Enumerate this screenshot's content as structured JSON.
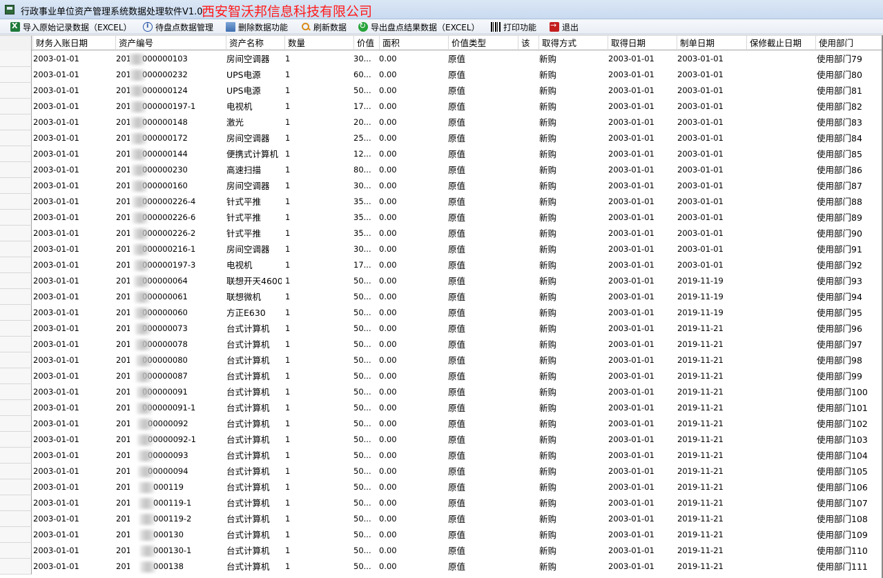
{
  "window": {
    "title": "行政事业单位资产管理系统数据处理软件V1.0",
    "brand_overlay": "西安智沃邦信息科技有限公司"
  },
  "toolbar": [
    {
      "label": "导入原始记录数据（EXCEL）",
      "icon": "excel-icon"
    },
    {
      "label": "待盘点数据管理",
      "icon": "info-icon"
    },
    {
      "label": "删除数据功能",
      "icon": "trash-icon"
    },
    {
      "label": "刷新数据",
      "icon": "search-icon"
    },
    {
      "label": "导出盘点结果数据（EXCEL）",
      "icon": "export-icon"
    },
    {
      "label": "打印功能",
      "icon": "barcode-icon"
    },
    {
      "label": "退出",
      "icon": "exit-icon"
    }
  ],
  "table": {
    "columns": [
      "财务入账日期",
      "资产编号",
      "资产名称",
      "数量",
      "价值",
      "面积",
      "价值类型",
      "该",
      "取得方式",
      "取得日期",
      "制单日期",
      "保修截止日期",
      "使用部门"
    ],
    "rows": [
      [
        "2003-01-01",
        "201",
        "000000103",
        "房间空调器",
        "1",
        "30...",
        "0.00",
        "原值",
        "新购",
        "2003-01-01",
        "2003-01-01",
        "",
        "使用部门79"
      ],
      [
        "2003-01-01",
        "201",
        "000000232",
        "UPS电源",
        "1",
        "60...",
        "0.00",
        "原值",
        "新购",
        "2003-01-01",
        "2003-01-01",
        "",
        "使用部门80"
      ],
      [
        "2003-01-01",
        "201",
        "000000124",
        "UPS电源",
        "1",
        "50...",
        "0.00",
        "原值",
        "新购",
        "2003-01-01",
        "2003-01-01",
        "",
        "使用部门81"
      ],
      [
        "2003-01-01",
        "201",
        "000000197-1",
        "电视机",
        "1",
        "17...",
        "0.00",
        "原值",
        "新购",
        "2003-01-01",
        "2003-01-01",
        "",
        "使用部门82"
      ],
      [
        "2003-01-01",
        "201",
        "000000148",
        "激光",
        "1",
        "20...",
        "0.00",
        "原值",
        "新购",
        "2003-01-01",
        "2003-01-01",
        "",
        "使用部门83"
      ],
      [
        "2003-01-01",
        "201",
        "000000172",
        "房间空调器",
        "1",
        "25...",
        "0.00",
        "原值",
        "新购",
        "2003-01-01",
        "2003-01-01",
        "",
        "使用部门84"
      ],
      [
        "2003-01-01",
        "201",
        "000000144",
        "便携式计算机",
        "1",
        "12...",
        "0.00",
        "原值",
        "新购",
        "2003-01-01",
        "2003-01-01",
        "",
        "使用部门85"
      ],
      [
        "2003-01-01",
        "201",
        "000000230",
        "高速扫描",
        "1",
        "80...",
        "0.00",
        "原值",
        "新购",
        "2003-01-01",
        "2003-01-01",
        "",
        "使用部门86"
      ],
      [
        "2003-01-01",
        "201",
        "000000160",
        "房间空调器",
        "1",
        "30...",
        "0.00",
        "原值",
        "新购",
        "2003-01-01",
        "2003-01-01",
        "",
        "使用部门87"
      ],
      [
        "2003-01-01",
        "201",
        "000000226-4",
        "针式平推",
        "1",
        "35...",
        "0.00",
        "原值",
        "新购",
        "2003-01-01",
        "2003-01-01",
        "",
        "使用部门88"
      ],
      [
        "2003-01-01",
        "201",
        "000000226-6",
        "针式平推",
        "1",
        "35...",
        "0.00",
        "原值",
        "新购",
        "2003-01-01",
        "2003-01-01",
        "",
        "使用部门89"
      ],
      [
        "2003-01-01",
        "201",
        "000000226-2",
        "针式平推",
        "1",
        "35...",
        "0.00",
        "原值",
        "新购",
        "2003-01-01",
        "2003-01-01",
        "",
        "使用部门90"
      ],
      [
        "2003-01-01",
        "201",
        "000000216-1",
        "房间空调器",
        "1",
        "30...",
        "0.00",
        "原值",
        "新购",
        "2003-01-01",
        "2003-01-01",
        "",
        "使用部门91"
      ],
      [
        "2003-01-01",
        "201",
        "000000197-3",
        "电视机",
        "1",
        "17...",
        "0.00",
        "原值",
        "新购",
        "2003-01-01",
        "2003-01-01",
        "",
        "使用部门92"
      ],
      [
        "2003-01-01",
        "201",
        "000000064",
        "联想开天4600",
        "1",
        "50...",
        "0.00",
        "原值",
        "新购",
        "2003-01-01",
        "2019-11-19",
        "",
        "使用部门93"
      ],
      [
        "2003-01-01",
        "201",
        "000000061",
        "联想微机",
        "1",
        "50...",
        "0.00",
        "原值",
        "新购",
        "2003-01-01",
        "2019-11-19",
        "",
        "使用部门94"
      ],
      [
        "2003-01-01",
        "201",
        "000000060",
        "方正E630",
        "1",
        "50...",
        "0.00",
        "原值",
        "新购",
        "2003-01-01",
        "2019-11-19",
        "",
        "使用部门95"
      ],
      [
        "2003-01-01",
        "201",
        "000000073",
        "台式计算机",
        "1",
        "50...",
        "0.00",
        "原值",
        "新购",
        "2003-01-01",
        "2019-11-21",
        "",
        "使用部门96"
      ],
      [
        "2003-01-01",
        "201",
        "000000078",
        "台式计算机",
        "1",
        "50...",
        "0.00",
        "原值",
        "新购",
        "2003-01-01",
        "2019-11-21",
        "",
        "使用部门97"
      ],
      [
        "2003-01-01",
        "201",
        "000000080",
        "台式计算机",
        "1",
        "50...",
        "0.00",
        "原值",
        "新购",
        "2003-01-01",
        "2019-11-21",
        "",
        "使用部门98"
      ],
      [
        "2003-01-01",
        "201",
        "000000087",
        "台式计算机",
        "1",
        "50...",
        "0.00",
        "原值",
        "新购",
        "2003-01-01",
        "2019-11-21",
        "",
        "使用部门99"
      ],
      [
        "2003-01-01",
        "201",
        "000000091",
        "台式计算机",
        "1",
        "50...",
        "0.00",
        "原值",
        "新购",
        "2003-01-01",
        "2019-11-21",
        "",
        "使用部门100"
      ],
      [
        "2003-01-01",
        "201",
        "000000091-1",
        "台式计算机",
        "1",
        "50...",
        "0.00",
        "原值",
        "新购",
        "2003-01-01",
        "2019-11-21",
        "",
        "使用部门101"
      ],
      [
        "2003-01-01",
        "201",
        "00000092",
        "台式计算机",
        "1",
        "50...",
        "0.00",
        "原值",
        "新购",
        "2003-01-01",
        "2019-11-21",
        "",
        "使用部门102"
      ],
      [
        "2003-01-01",
        "201",
        "00000092-1",
        "台式计算机",
        "1",
        "50...",
        "0.00",
        "原值",
        "新购",
        "2003-01-01",
        "2019-11-21",
        "",
        "使用部门103"
      ],
      [
        "2003-01-01",
        "201",
        "00000093",
        "台式计算机",
        "1",
        "50...",
        "0.00",
        "原值",
        "新购",
        "2003-01-01",
        "2019-11-21",
        "",
        "使用部门104"
      ],
      [
        "2003-01-01",
        "201",
        "00000094",
        "台式计算机",
        "1",
        "50...",
        "0.00",
        "原值",
        "新购",
        "2003-01-01",
        "2019-11-21",
        "",
        "使用部门105"
      ],
      [
        "2003-01-01",
        "2017",
        "000119",
        "台式计算机",
        "1",
        "50...",
        "0.00",
        "原值",
        "新购",
        "2003-01-01",
        "2019-11-21",
        "",
        "使用部门106"
      ],
      [
        "2003-01-01",
        "2017",
        "000119-1",
        "台式计算机",
        "1",
        "50...",
        "0.00",
        "原值",
        "新购",
        "2003-01-01",
        "2019-11-21",
        "",
        "使用部门107"
      ],
      [
        "2003-01-01",
        "2017",
        "000119-2",
        "台式计算机",
        "1",
        "50...",
        "0.00",
        "原值",
        "新购",
        "2003-01-01",
        "2019-11-21",
        "",
        "使用部门108"
      ],
      [
        "2003-01-01",
        "2017",
        "000130",
        "台式计算机",
        "1",
        "50...",
        "0.00",
        "原值",
        "新购",
        "2003-01-01",
        "2019-11-21",
        "",
        "使用部门109"
      ],
      [
        "2003-01-01",
        "2017",
        "000130-1",
        "台式计算机",
        "1",
        "50...",
        "0.00",
        "原值",
        "新购",
        "2003-01-01",
        "2019-11-21",
        "",
        "使用部门110"
      ],
      [
        "2003-01-01",
        "2017",
        "000138",
        "台式计算机",
        "1",
        "50...",
        "0.00",
        "原值",
        "新购",
        "2003-01-01",
        "2019-11-21",
        "",
        "使用部门111"
      ]
    ]
  }
}
